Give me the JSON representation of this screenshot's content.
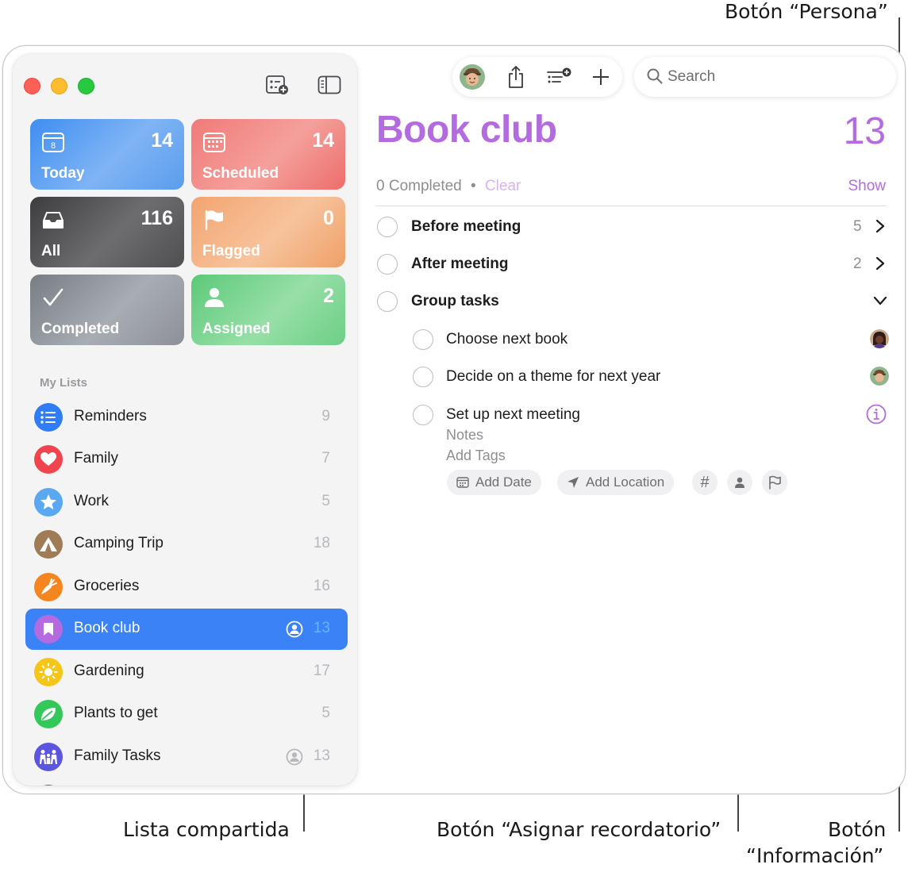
{
  "annotations": {
    "persona": "Botón “Persona”",
    "shared_list": "Lista compartida",
    "assign": "Botón “Asignar recordatorio”",
    "info_line1": "Botón",
    "info_line2": "“Información”"
  },
  "smart_lists": [
    {
      "label": "Today",
      "count": "14",
      "icon": "calendar-today-icon",
      "color": "#5a9ded"
    },
    {
      "label": "Scheduled",
      "count": "14",
      "icon": "calendar-grid-icon",
      "color": "#ec6d6a"
    },
    {
      "label": "All",
      "count": "116",
      "icon": "tray-icon",
      "color": "#4f4f51"
    },
    {
      "label": "Flagged",
      "count": "0",
      "icon": "flag-icon",
      "color": "#efa067"
    },
    {
      "label": "Completed",
      "count": "",
      "icon": "checkmark-icon",
      "color": "#8d9197"
    },
    {
      "label": "Assigned",
      "count": "2",
      "icon": "person-icon",
      "color": "#6ccf86"
    }
  ],
  "today_day": "8",
  "my_lists_heading": "My Lists",
  "lists": [
    {
      "name": "Reminders",
      "count": "9",
      "color": "#2f7cf6",
      "icon": "list-bullet-icon"
    },
    {
      "name": "Family",
      "count": "7",
      "color": "#f0454f",
      "icon": "heart-icon"
    },
    {
      "name": "Work",
      "count": "5",
      "color": "#5aa8f2",
      "icon": "star-icon"
    },
    {
      "name": "Camping Trip",
      "count": "18",
      "color": "#a07c56",
      "icon": "tent-icon"
    },
    {
      "name": "Groceries",
      "count": "16",
      "color": "#f5861f",
      "icon": "carrot-icon"
    },
    {
      "name": "Book club",
      "count": "13",
      "color": "#b46be0",
      "icon": "bookmark-icon",
      "selected": true,
      "shared": true
    },
    {
      "name": "Gardening",
      "count": "17",
      "color": "#f5c518",
      "icon": "sun-icon"
    },
    {
      "name": "Plants to get",
      "count": "5",
      "color": "#34c759",
      "icon": "leaf-icon"
    },
    {
      "name": "Family Tasks",
      "count": "13",
      "color": "#5b55e0",
      "icon": "family-icon",
      "shared": true
    }
  ],
  "search": {
    "placeholder": "Search"
  },
  "main": {
    "title": "Book club",
    "count": "13",
    "completed_text": "0 Completed",
    "clear_label": "Clear",
    "show_label": "Show",
    "groups": [
      {
        "title": "Before meeting",
        "count": "5"
      },
      {
        "title": "After meeting",
        "count": "2"
      },
      {
        "title": "Group tasks",
        "count": ""
      }
    ],
    "subtasks": [
      {
        "title": "Choose next book"
      },
      {
        "title": "Decide on a theme for next year"
      },
      {
        "title": "Set up next meeting"
      }
    ],
    "notes_placeholder": "Notes",
    "tags_placeholder": "Add Tags",
    "add_date": "Add Date",
    "add_location": "Add Location"
  },
  "colors": {
    "accent": "#b46be0",
    "selection": "#3b82f7"
  }
}
